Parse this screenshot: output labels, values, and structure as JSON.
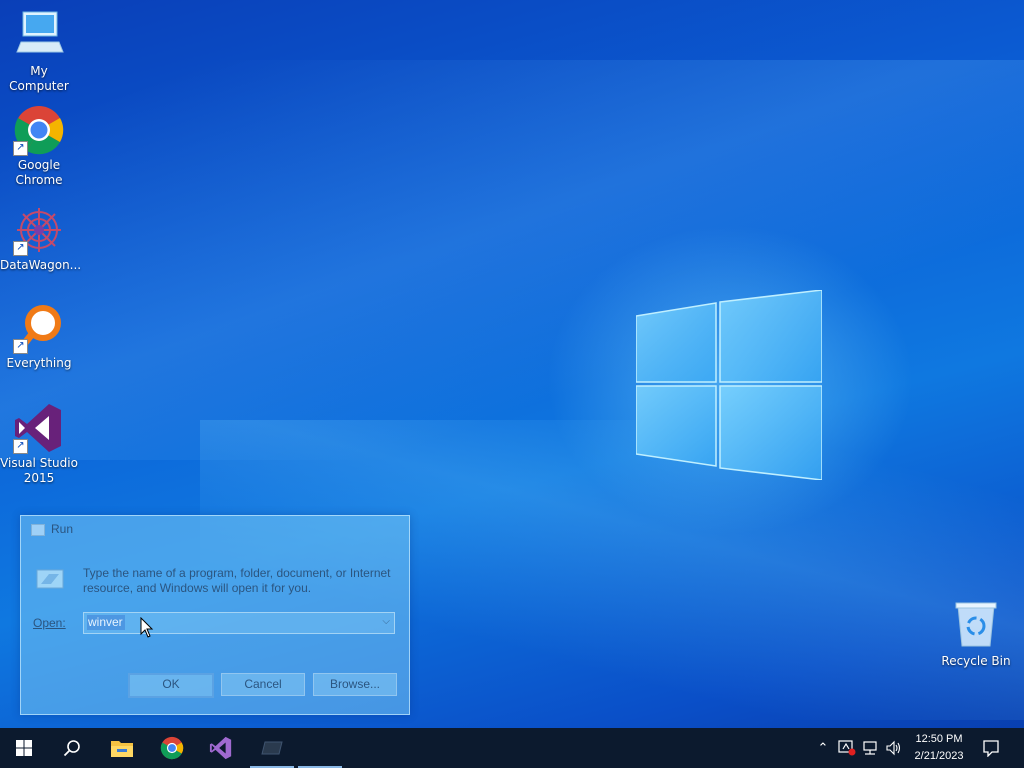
{
  "desktop": {
    "icons": [
      {
        "label": "My Computer"
      },
      {
        "label": "Google Chrome"
      },
      {
        "label": "DataWagon..."
      },
      {
        "label": "Everything"
      },
      {
        "label": "Visual Studio 2015"
      },
      {
        "label": "Recycle Bin"
      }
    ]
  },
  "run_dialog": {
    "title": "Run",
    "description": "Type the name of a program, folder, document, or Internet resource, and Windows will open it for you.",
    "open_label": "Open:",
    "open_value": "winver",
    "ok_label": "OK",
    "cancel_label": "Cancel",
    "browse_label": "Browse..."
  },
  "taskbar": {
    "clock_time": "12:50 PM",
    "clock_date": "2/21/2023"
  },
  "colors": {
    "taskbar": "#0c1a2e",
    "desktop_accent": "#0b5fd6"
  }
}
